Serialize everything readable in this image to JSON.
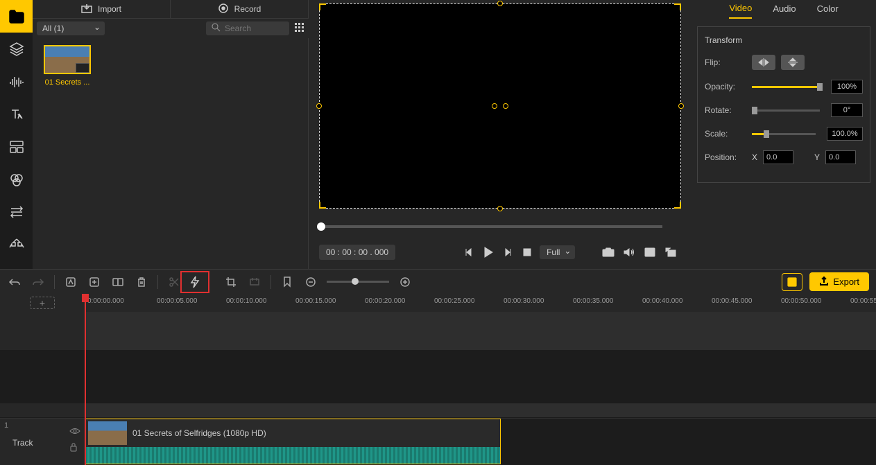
{
  "sidebar": {
    "tools": [
      "media",
      "layers",
      "audio",
      "text",
      "templates",
      "filters",
      "transitions",
      "motion"
    ]
  },
  "top_toolbar": {
    "import_label": "Import",
    "record_label": "Record"
  },
  "filter_bar": {
    "dropdown_label": "All (1)",
    "search_placeholder": "Search"
  },
  "media": {
    "clips": [
      {
        "name": "01 Secrets ..."
      }
    ]
  },
  "playback": {
    "timecode": "00 : 00 : 00 . 000",
    "size_label": "Full"
  },
  "props": {
    "tabs": {
      "video": "Video",
      "audio": "Audio",
      "color": "Color"
    },
    "transform_header": "Transform",
    "flip_label": "Flip:",
    "opacity_label": "Opacity:",
    "opacity_value": "100%",
    "rotate_label": "Rotate:",
    "rotate_value": "0°",
    "scale_label": "Scale:",
    "scale_value": "100.0%",
    "position_label": "Position:",
    "position_x_label": "X",
    "position_x_value": "0.0",
    "position_y_label": "Y",
    "position_y_value": "0.0"
  },
  "export": {
    "label": "Export"
  },
  "timeline": {
    "marks": [
      "0:00:00.000",
      "00:00:05.000",
      "00:00:10.000",
      "00:00:15.000",
      "00:00:20.000",
      "00:00:25.000",
      "00:00:30.000",
      "00:00:35.000",
      "00:00:40.000",
      "00:00:45.000",
      "00:00:50.000",
      "00:00:55"
    ],
    "track_number": "1",
    "track_label": "Track",
    "clip_title": "01 Secrets of Selfridges (1080p HD)"
  }
}
